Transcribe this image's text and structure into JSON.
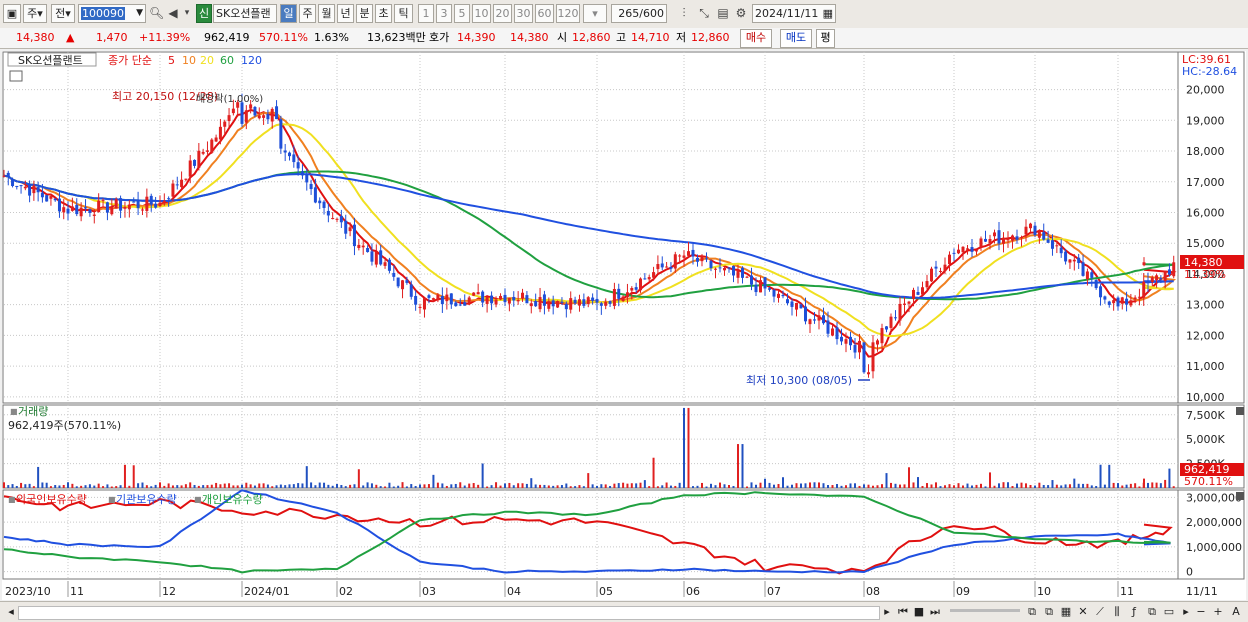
{
  "toolbar": {
    "period_label": "주",
    "jeon_label": "전",
    "stock_code": "100090",
    "badge": "신",
    "stock_name": "SK오션플랜",
    "periods": [
      "일",
      "주",
      "월",
      "년",
      "분",
      "초",
      "틱"
    ],
    "active_period": "일",
    "intervals": [
      "1",
      "3",
      "5",
      "10",
      "20",
      "30",
      "60",
      "120"
    ],
    "count": "265",
    "count_total": "/600",
    "date": "2024/11/11"
  },
  "info": {
    "price": "14,380",
    "up_arrow": "▲",
    "change": "1,470",
    "change_pct": "+11.39%",
    "volume": "962,419",
    "volume_ratio": "570.11%",
    "turnover": "1.63%",
    "amount": "13,623백만",
    "hoga_label": "호가",
    "ask": "14,390",
    "bid": "14,380",
    "open_label": "시",
    "open": "12,860",
    "high_label": "고",
    "high": "14,710",
    "low_label": "저",
    "low": "12,860",
    "buy_label": "매수",
    "sell_label": "매도",
    "eval_label": "평"
  },
  "price_panel": {
    "title": "SK오션플랜트",
    "ma_label": "종가 단순",
    "ma_periods": [
      "5",
      "10",
      "20",
      "60",
      "120"
    ],
    "ma_colors": [
      "#e01010",
      "#f08020",
      "#f0e020",
      "#20a040",
      "#2050e0"
    ],
    "lc": "LC:39.61",
    "hc": "HC:-28.64",
    "high_annot": "최고 20,150 (12/28)",
    "div_annot": "배당락(1.00%)",
    "low_annot": "최저 10,300 (08/05)",
    "current_price_tag": "14,380",
    "current_pct_tag": "11.39%",
    "yticks": [
      "20,000",
      "19,000",
      "18,000",
      "17,000",
      "16,000",
      "15,000",
      "14,000",
      "13,000",
      "12,000",
      "11,000",
      "10,000"
    ]
  },
  "volume_panel": {
    "title": "거래량",
    "value": "962,419주(570.11%)",
    "yticks": [
      "7,500K",
      "5,000K",
      "2,500K"
    ],
    "current_tag": "962,419",
    "current_pct": "570.11%"
  },
  "holding_panel": {
    "legend": [
      "외국인보유수량",
      "기관보유수량",
      "개인보유수량"
    ],
    "colors": [
      "#e01010",
      "#2050e0",
      "#20a040"
    ],
    "yticks": [
      "3,000,000",
      "2,000,000",
      "1,000,000",
      "0"
    ]
  },
  "x_axis": {
    "labels": [
      "2023/10",
      "11",
      "12",
      "2024/01",
      "02",
      "03",
      "04",
      "05",
      "06",
      "07",
      "08",
      "09",
      "10",
      "11",
      "11/11"
    ]
  },
  "chart_data": {
    "type": "line",
    "series_hint": "SK오션플랜트 daily OHLC with moving averages 5/10/20/60/120",
    "price_range": [
      9800,
      20800
    ],
    "ohlc_anchor_points": [
      {
        "x": "2023/10",
        "close": 17200
      },
      {
        "x": "11",
        "close": 16100
      },
      {
        "x": "12",
        "close": 16300
      },
      {
        "x": "2024/01",
        "close": 19500
      },
      {
        "x": "02",
        "close": 15700
      },
      {
        "x": "03",
        "close": 13100
      },
      {
        "x": "04",
        "close": 13300
      },
      {
        "x": "05",
        "close": 13000
      },
      {
        "x": "06",
        "close": 14600
      },
      {
        "x": "07",
        "close": 13500
      },
      {
        "x": "08",
        "close": 11500
      },
      {
        "x": "09",
        "close": 14800
      },
      {
        "x": "10",
        "close": 15500
      },
      {
        "x": "11",
        "close": 12900
      },
      {
        "x": "11/11",
        "close": 14380
      }
    ],
    "high_marker": {
      "value": 20150,
      "date": "12/28"
    },
    "low_marker": {
      "value": 10300,
      "date": "08/05"
    },
    "volume_range_k": [
      0,
      8500
    ],
    "holding_range": [
      -300000,
      3300000
    ]
  }
}
